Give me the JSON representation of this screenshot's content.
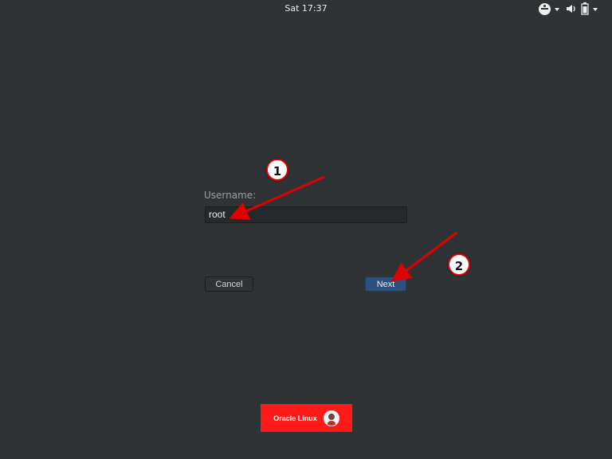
{
  "topbar": {
    "clock": "Sat 17:37",
    "tray": {
      "accessibility_icon": "accessibility-icon",
      "volume_icon": "volume-icon",
      "battery_icon": "battery-icon"
    }
  },
  "login": {
    "username_label": "Username:",
    "username_value": "root",
    "cancel_label": "Cancel",
    "next_label": "Next"
  },
  "annotations": {
    "marker_1": "1",
    "marker_2": "2"
  },
  "brand": {
    "text": "Oracle Linux"
  },
  "colors": {
    "background": "#2f3335",
    "accent_button": "#2d4f7b",
    "annotation_red": "#e00000",
    "brand_red": "#ff1a1a"
  }
}
